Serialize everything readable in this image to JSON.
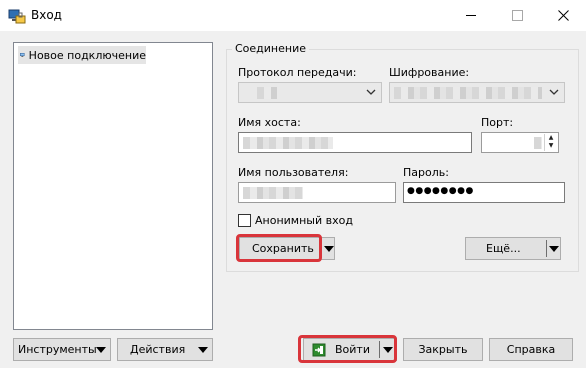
{
  "window": {
    "title": "Вход",
    "controls": {
      "minimize": "minimize-icon",
      "maximize": "maximize-icon",
      "close": "close-icon"
    }
  },
  "sites": {
    "items": [
      {
        "label": "Новое подключение",
        "icon": "monitor-icon",
        "selected": true
      }
    ]
  },
  "connection": {
    "group_label": "Соединение",
    "protocol_label": "Протокол передачи:",
    "encryption_label": "Шифрование:",
    "host_label": "Имя хоста:",
    "port_label": "Порт:",
    "username_label": "Имя пользователя:",
    "password_label": "Пароль:",
    "password_value": "●●●●●●●●",
    "anonymous_label": "Анонимный вход",
    "anonymous_checked": false,
    "save_label": "Сохранить",
    "more_label": "Ещё..."
  },
  "footer": {
    "tools_label": "Инструменты",
    "actions_label": "Действия",
    "login_label": "Войти",
    "close_label": "Закрыть",
    "help_label": "Справка"
  },
  "colors": {
    "highlight": "#d9353b",
    "window_bg": "#f0f0f0",
    "login_icon": "#2e8b2e"
  }
}
